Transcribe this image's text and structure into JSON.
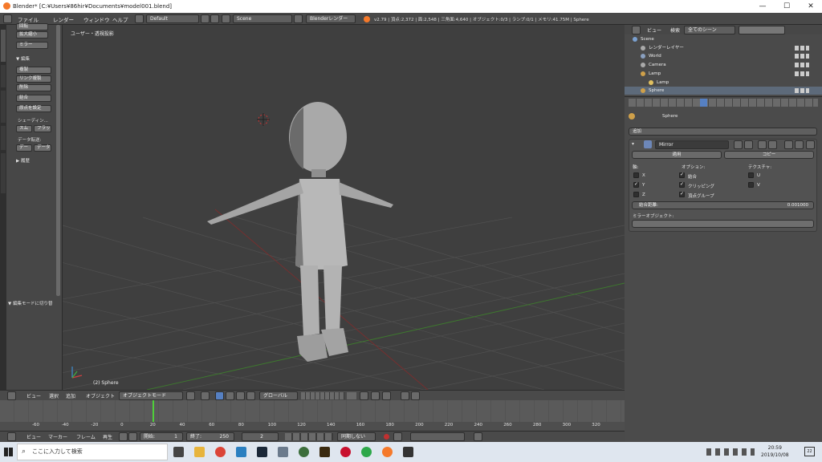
{
  "window": {
    "title": "Blender* [C:¥Users¥86hir¥Documents¥model001.blend]",
    "min": "—",
    "max": "☐",
    "close": "✕"
  },
  "infobar": {
    "menus": [
      "ファイル",
      "レンダー",
      "ウィンドウ",
      "ヘルプ"
    ],
    "layout": "Default",
    "scene": "Scene",
    "engine": "Blenderレンダー",
    "stats": "v2.79 | 頂点:2,372 | 面:2,548 | 三角面:4,640 | オブジェクト:0/3 | ランプ:0/1 | メモリ:41.75M | Sphere"
  },
  "toolshelf": {
    "tabs": [
      "ツール",
      "作成",
      "シェーディング",
      "オプション",
      "グリースペンシル"
    ],
    "b_rotate": "回転",
    "b_scale": "拡大縮小",
    "b_mirror": "ミラー",
    "edit_header": "▼ 編集",
    "b_duplicate": "複製",
    "b_link_dup": "リンク複製",
    "b_delete": "削除",
    "b_join": "結合",
    "b_origin": "原点を設定",
    "shading_label": "シェーディン...",
    "b_smooth": "スム",
    "b_flat": "フラッ",
    "data_transfer": "データ転送:",
    "b_data": "デー",
    "b_data2": "データ",
    "history": "▶ 履歴",
    "editmode": "▼ 編集モードに切り替"
  },
  "viewport": {
    "header": "ユーザー・透視投影",
    "object_label": "(2) Sphere"
  },
  "header3d": {
    "menus": [
      "ビュー",
      "選択",
      "追加",
      "オブジェクト"
    ],
    "mode": "オブジェクトモード",
    "orientation": "グローバル"
  },
  "timeline": {
    "ticks": [
      "-60",
      "-40",
      "-20",
      "0",
      "20",
      "40",
      "60",
      "80",
      "100",
      "120",
      "140",
      "160",
      "180",
      "200",
      "220",
      "240",
      "260",
      "280",
      "300",
      "320"
    ],
    "menus": [
      "ビュー",
      "マーカー",
      "フレーム",
      "再生"
    ],
    "start_label": "開始:",
    "start": "1",
    "end_label": "終了:",
    "end": "250",
    "current": "2",
    "sync": "同期しない"
  },
  "outliner": {
    "menus": [
      "ビュー",
      "検索"
    ],
    "filter": "全てのシーン",
    "items": [
      {
        "label": "Scene",
        "indent": 0
      },
      {
        "label": "レンダーレイヤー",
        "indent": 1
      },
      {
        "label": "World",
        "indent": 1
      },
      {
        "label": "Camera",
        "indent": 1
      },
      {
        "label": "Lamp",
        "indent": 1
      },
      {
        "label": "Lamp",
        "indent": 2
      },
      {
        "label": "Sphere",
        "indent": 1
      }
    ]
  },
  "props": {
    "object": "Sphere",
    "add": "追加",
    "modifier_name": "Mirror",
    "apply": "適用",
    "copy": "コピー",
    "axis_label": "軸:",
    "options_label": "オプション:",
    "texture_label": "テクスチャ:",
    "x": "X",
    "y": "Y",
    "z": "Z",
    "merge": "結合",
    "clipping": "クリッピング",
    "vgroup": "頂点グループ",
    "u": "U",
    "v": "V",
    "merge_dist_label": "結合距離:",
    "merge_dist": "0.001000",
    "mirror_obj": "ミラーオブジェクト:"
  },
  "taskbar": {
    "search": "ここに入力して検索",
    "time": "20:59",
    "date": "2019/10/08",
    "notif": "22"
  }
}
